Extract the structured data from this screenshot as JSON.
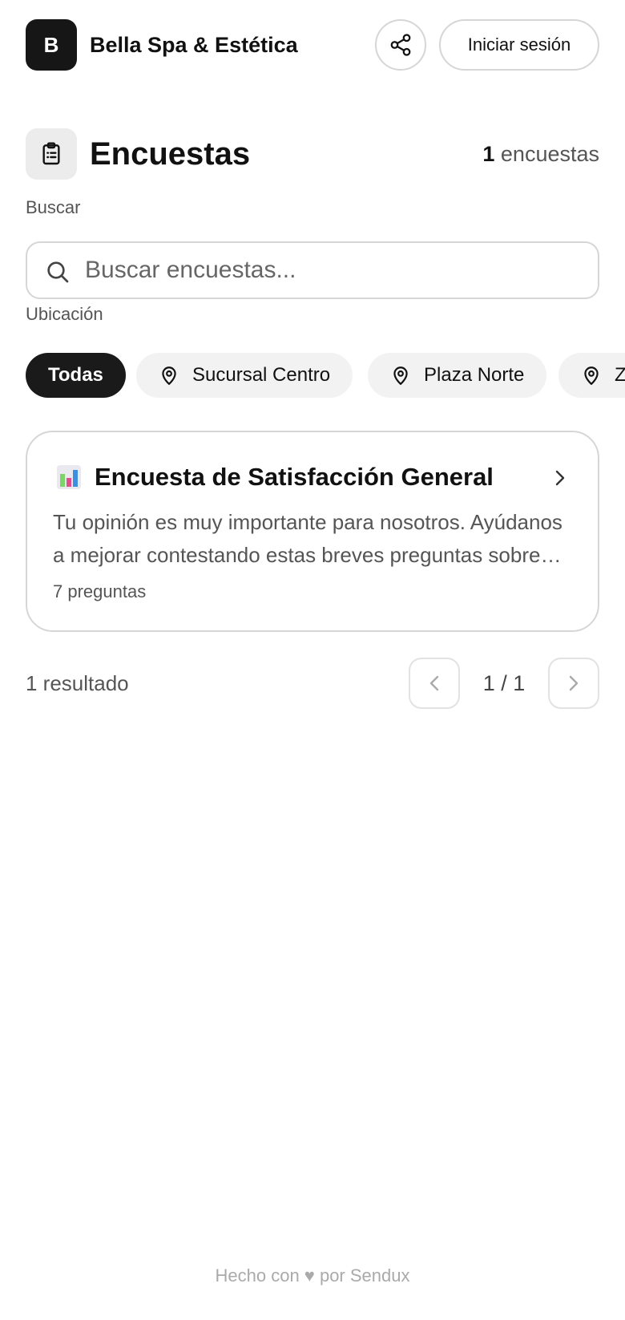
{
  "header": {
    "logo_letter": "B",
    "business_name": "Bella Spa & Estética",
    "share_icon": "share-icon",
    "login_label": "Iniciar sesión"
  },
  "title_section": {
    "icon": "clipboard-list-icon",
    "title": "Encuestas",
    "count": "1",
    "count_suffix": "encuestas"
  },
  "search": {
    "label": "Buscar",
    "placeholder": "Buscar encuestas...",
    "value": ""
  },
  "location": {
    "label": "Ubicación",
    "chips": [
      {
        "label": "Todas",
        "selected": true
      },
      {
        "label": "Sucursal Centro",
        "selected": false,
        "icon": "map-pin-icon"
      },
      {
        "label": "Plaza Norte",
        "selected": false,
        "icon": "map-pin-icon"
      },
      {
        "label": "Zona Sur",
        "selected": false,
        "icon": "map-pin-icon"
      }
    ]
  },
  "surveys": [
    {
      "icon": "bar-chart-emoji",
      "title": "Encuesta de Satisfacción General",
      "description": "Tu opinión es muy importante para nosotros. Ayúdanos a mejorar contestando estas breves preguntas sobre tu experiencia.",
      "questions": "7 preguntas"
    }
  ],
  "pagination": {
    "results_label": "1 resultado",
    "page_label": "1 / 1"
  },
  "footer": {
    "text": "Hecho con ♥ por Sendux"
  },
  "colors": {
    "primary": "#1a1a1a",
    "border": "#d6d6d6",
    "muted_text": "#555555",
    "chip_bg": "#f2f2f2",
    "footer_text": "#aaaaaa"
  }
}
